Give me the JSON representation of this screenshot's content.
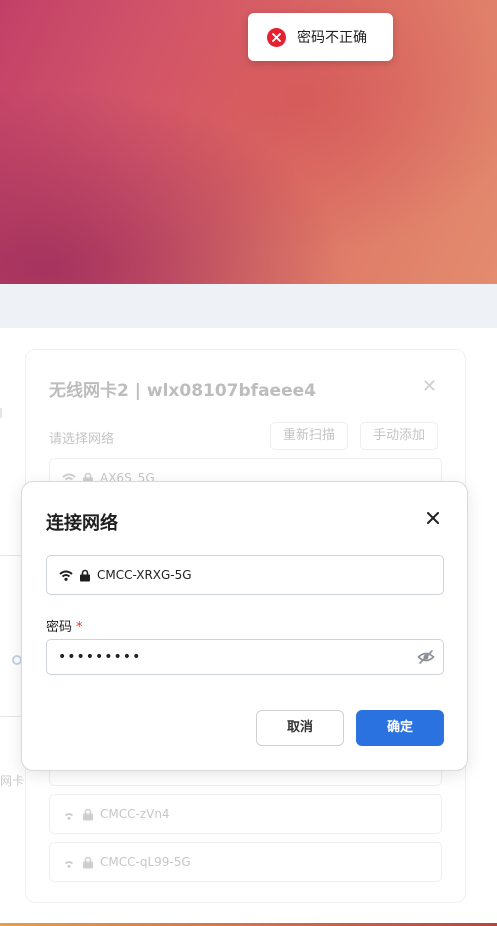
{
  "toast": {
    "message": "密码不正确",
    "icon": "error-circle-icon",
    "color": "#e5202f"
  },
  "panel": {
    "title": "无线网卡2 | wlx08107bfaeee4",
    "select_label": "请选择网络",
    "rescan_label": "重新扫描",
    "manual_add_label": "手动添加",
    "networks": [
      {
        "ssid": "AX6S_5G"
      },
      {
        "ssid": "CMCC-zVn4"
      },
      {
        "ssid": "CMCC-qL99-5G"
      }
    ]
  },
  "background": {
    "left_text": "网卡"
  },
  "dialog": {
    "title": "连接网络",
    "ssid": "CMCC-XRXG-5G",
    "password_label": "密码",
    "required_mark": "*",
    "password_value": "•••••••••",
    "cancel_label": "取消",
    "confirm_label": "确定",
    "accent": "#2a72e0"
  }
}
